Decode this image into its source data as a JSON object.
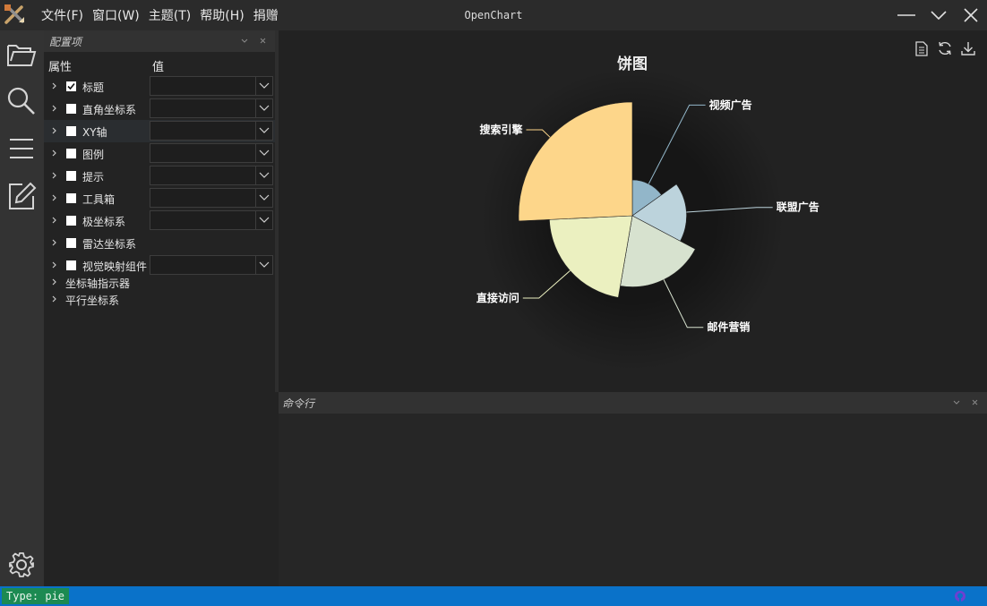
{
  "titlebar": {
    "title": "OpenChart",
    "menu": [
      "文件(F)",
      "窗口(W)",
      "主题(T)",
      "帮助(H)",
      "捐赠"
    ]
  },
  "activity": [
    "folder-icon",
    "search-icon",
    "list-icon",
    "edit-icon",
    "settings-icon"
  ],
  "config_panel": {
    "title": "配置项",
    "col_property": "属性",
    "col_value": "值",
    "items": [
      {
        "label": "标题",
        "checked": true,
        "has_checkbox": true,
        "has_combo": true
      },
      {
        "label": "直角坐标系",
        "checked": false,
        "has_checkbox": true,
        "has_combo": true
      },
      {
        "label": "XY轴",
        "checked": false,
        "has_checkbox": true,
        "has_combo": true
      },
      {
        "label": "图例",
        "checked": false,
        "has_checkbox": true,
        "has_combo": true
      },
      {
        "label": "提示",
        "checked": false,
        "has_checkbox": true,
        "has_combo": true
      },
      {
        "label": "工具箱",
        "checked": false,
        "has_checkbox": true,
        "has_combo": true
      },
      {
        "label": "极坐标系",
        "checked": false,
        "has_checkbox": true,
        "has_combo": true
      },
      {
        "label": "雷达坐标系",
        "checked": false,
        "has_checkbox": true,
        "has_combo": false
      },
      {
        "label": "视觉映射组件",
        "checked": false,
        "has_checkbox": true,
        "has_combo": true
      },
      {
        "label": "坐标轴指示器",
        "checked": false,
        "has_checkbox": false,
        "has_combo": false
      },
      {
        "label": "平行坐标系",
        "checked": false,
        "has_checkbox": false,
        "has_combo": false
      }
    ]
  },
  "chart_data": {
    "type": "pie",
    "subtype": "rose-radius",
    "title": "饼图",
    "slices": [
      {
        "name": "视频广告",
        "value": 235,
        "color": "#92b6c9"
      },
      {
        "name": "联盟广告",
        "value": 274,
        "color": "#bcd3dc"
      },
      {
        "name": "邮件营销",
        "value": 310,
        "color": "#d7e2cf"
      },
      {
        "name": "直接访问",
        "value": 335,
        "color": "#ebf0c0"
      },
      {
        "name": "搜索引擎",
        "value": 400,
        "color": "#fdd68a"
      }
    ]
  },
  "command_panel": {
    "title": "命令行"
  },
  "statusbar": {
    "type_text": "Type: pie"
  }
}
